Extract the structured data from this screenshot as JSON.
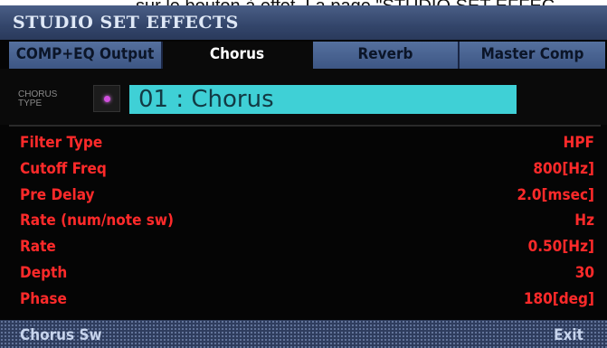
{
  "caption": "sur le bouton à effet. La page \"STUDIO SET EFFEC",
  "title": "STUDIO SET EFFECTS",
  "tabs": [
    {
      "label": "COMP+EQ Output"
    },
    {
      "label": "Chorus"
    },
    {
      "label": "Reverb"
    },
    {
      "label": "Master Comp"
    }
  ],
  "chorus_type": {
    "label_line1": "CHORUS",
    "label_line2": "TYPE",
    "value": "01 : Chorus",
    "indicator_color": "#d24fe0"
  },
  "params": [
    {
      "name": "Filter Type",
      "value": "HPF"
    },
    {
      "name": "Cutoff Freq",
      "value": "800[Hz]"
    },
    {
      "name": "Pre Delay",
      "value": "2.0[msec]"
    },
    {
      "name": "Rate (num/note sw)",
      "value": "Hz"
    },
    {
      "name": "Rate",
      "value": "0.50[Hz]"
    },
    {
      "name": "Depth",
      "value": "30"
    },
    {
      "name": "Phase",
      "value": "180[deg]"
    }
  ],
  "bottom": {
    "left": "Chorus Sw",
    "right": "Exit"
  },
  "colors": {
    "param_text": "#ff2a2a",
    "type_box": "#3fd0d6",
    "tab_inactive": "#4a6494",
    "title_bar": "#3a4d74"
  }
}
